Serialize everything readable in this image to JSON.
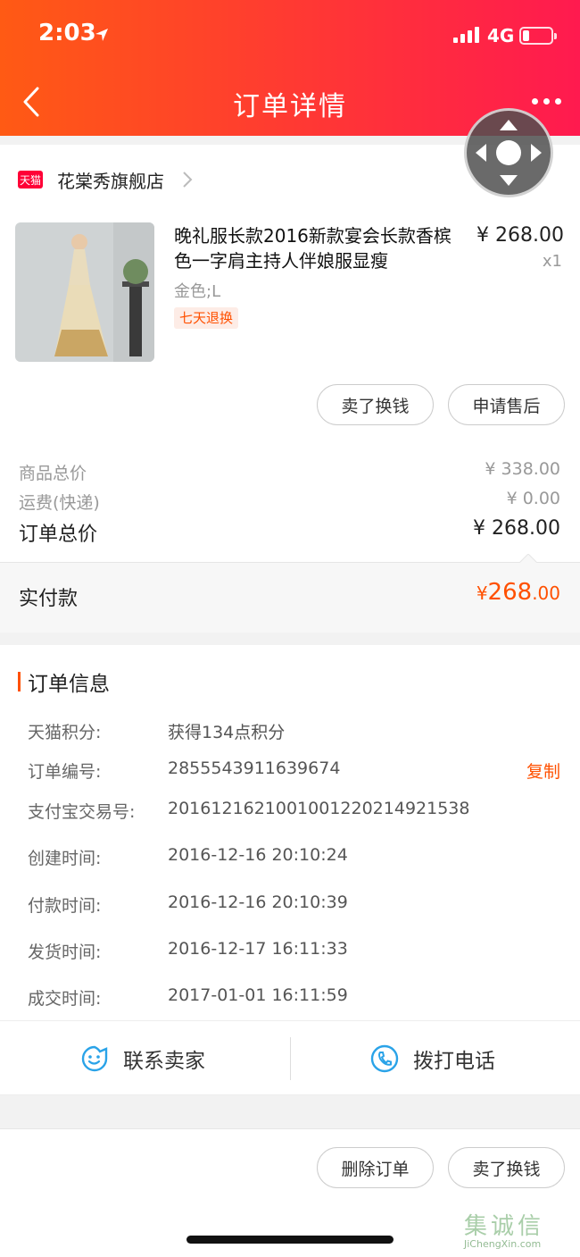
{
  "status_bar": {
    "time": "2:03",
    "network": "4G"
  },
  "nav": {
    "title": "订单详情"
  },
  "store": {
    "badge": "天猫",
    "name": "花棠秀旗舰店"
  },
  "product": {
    "title": "晚礼服长款2016新款宴会长款香槟色一字肩主持人伴娘服显瘦",
    "price": "¥ 268.00",
    "qty": "x1",
    "sku": "金色;L",
    "tag": "七天退换"
  },
  "item_actions": {
    "sell": "卖了换钱",
    "after_sale": "申请售后"
  },
  "summary": {
    "goods_label": "商品总价",
    "goods_value": "¥ 338.00",
    "shipping_label": "运费(快递)",
    "shipping_value": "¥ 0.00",
    "total_label": "订单总价",
    "total_value": "¥ 268.00"
  },
  "paid": {
    "label": "实付款",
    "currency": "¥",
    "integer": "268",
    "decimal": ".00"
  },
  "order_info": {
    "title": "订单信息",
    "copy": "复制",
    "rows": [
      {
        "label": "天猫积分:",
        "value": "获得134点积分"
      },
      {
        "label": "订单编号:",
        "value": "2855543911639674"
      },
      {
        "label": "支付宝交易号:",
        "value": "2016121621001001220214921538"
      },
      {
        "label": "创建时间:",
        "value": "2016-12-16 20:10:24"
      },
      {
        "label": "付款时间:",
        "value": "2016-12-16 20:10:39"
      },
      {
        "label": "发货时间:",
        "value": "2016-12-17 16:11:33"
      },
      {
        "label": "成交时间:",
        "value": "2017-01-01 16:11:59"
      }
    ]
  },
  "contact": {
    "seller": "联系卖家",
    "phone": "拨打电话"
  },
  "bottom_actions": {
    "delete": "删除订单",
    "sell": "卖了换钱"
  },
  "watermark": {
    "text": "集诚信",
    "sub": "JiChengXin.com"
  },
  "colors": {
    "accent": "#ff5000",
    "header_start": "#ff5a14",
    "header_end": "#ff1a4f",
    "icon_blue": "#2aa3e8"
  }
}
